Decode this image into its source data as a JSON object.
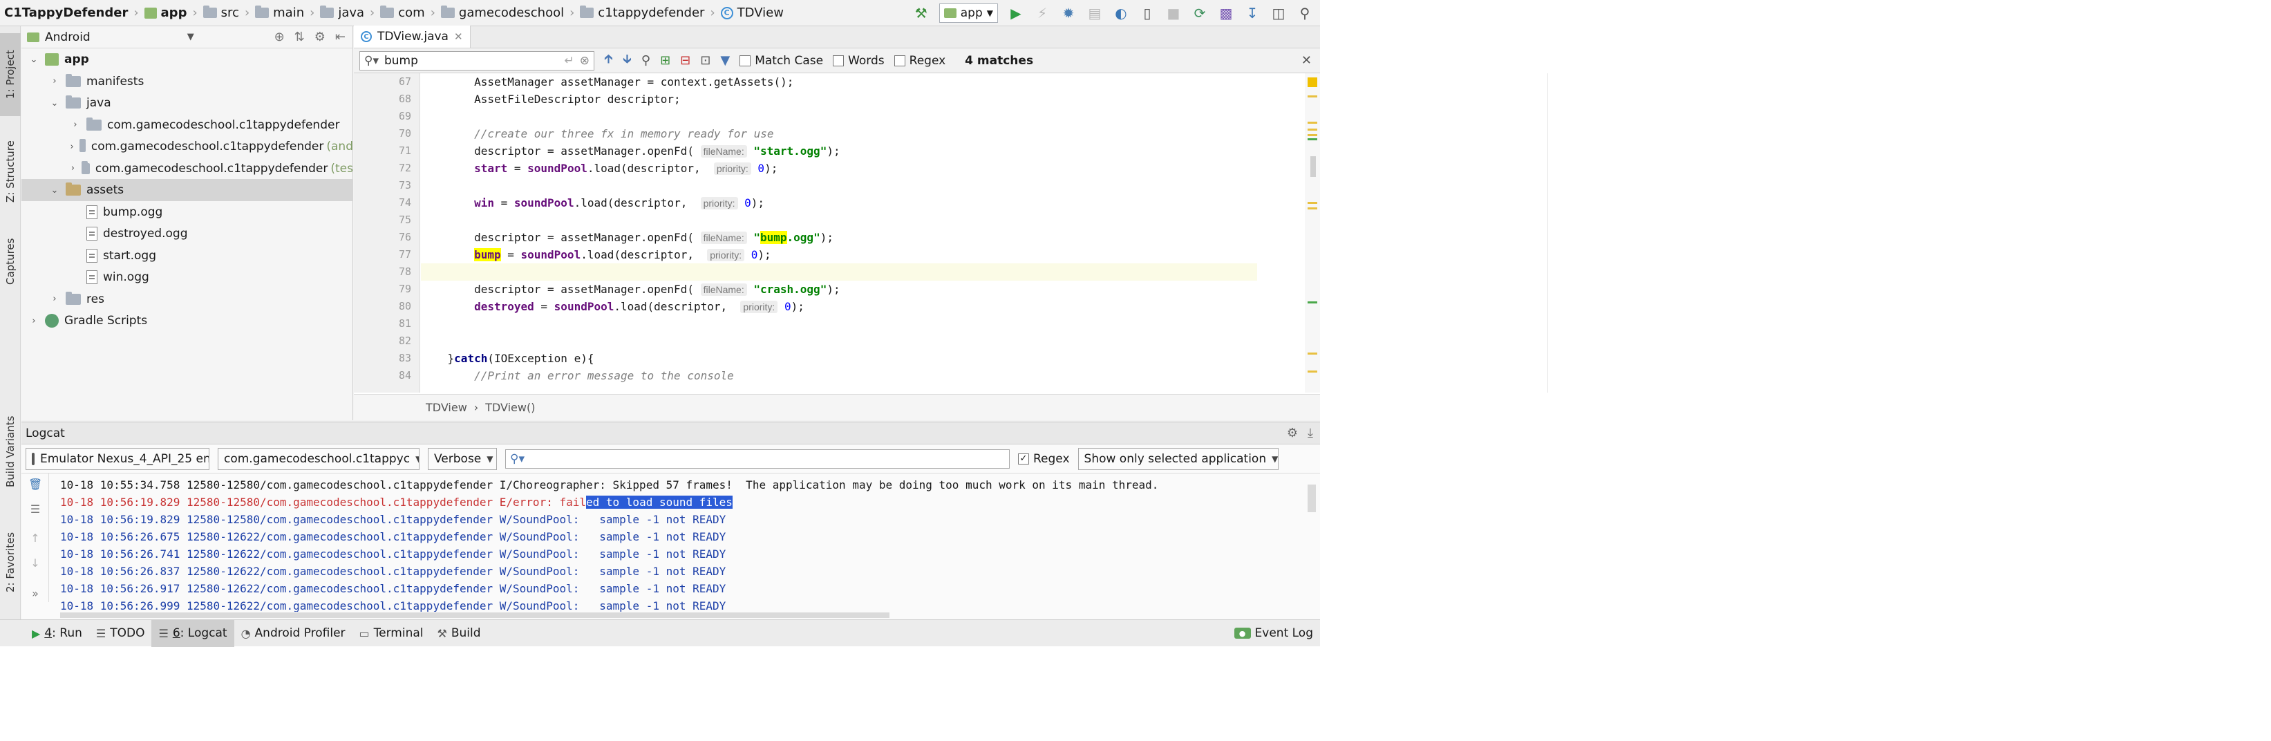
{
  "breadcrumbs": [
    "C1TappyDefender",
    "app",
    "src",
    "main",
    "java",
    "com",
    "gamecodeschool",
    "c1tappydefender",
    "TDView"
  ],
  "run_config": "app",
  "left_stripe_tabs": [
    "1: Project",
    "Z: Structure",
    "Captures",
    "Build Variants",
    "2: Favorites"
  ],
  "project_panel": {
    "view_label": "Android",
    "tree": [
      {
        "label": "app",
        "hint": "",
        "depth": 0,
        "kind": "module",
        "expanded": true,
        "bold": true
      },
      {
        "label": "manifests",
        "hint": "",
        "depth": 1,
        "kind": "folder",
        "expanded": false
      },
      {
        "label": "java",
        "hint": "",
        "depth": 1,
        "kind": "folder",
        "expanded": true
      },
      {
        "label": "com.gamecodeschool.c1tappydefender",
        "hint": "",
        "depth": 2,
        "kind": "folder",
        "expanded": false
      },
      {
        "label": "com.gamecodeschool.c1tappydefender",
        "hint": "(and",
        "depth": 2,
        "kind": "folder",
        "expanded": false
      },
      {
        "label": "com.gamecodeschool.c1tappydefender",
        "hint": "(tes",
        "depth": 2,
        "kind": "folder",
        "expanded": false
      },
      {
        "label": "assets",
        "hint": "",
        "depth": 1,
        "kind": "assets",
        "expanded": true,
        "selected": true
      },
      {
        "label": "bump.ogg",
        "hint": "",
        "depth": 2,
        "kind": "file"
      },
      {
        "label": "destroyed.ogg",
        "hint": "",
        "depth": 2,
        "kind": "file"
      },
      {
        "label": "start.ogg",
        "hint": "",
        "depth": 2,
        "kind": "file"
      },
      {
        "label": "win.ogg",
        "hint": "",
        "depth": 2,
        "kind": "file"
      },
      {
        "label": "res",
        "hint": "",
        "depth": 1,
        "kind": "folder",
        "expanded": false
      },
      {
        "label": "Gradle Scripts",
        "hint": "",
        "depth": 0,
        "kind": "gradle",
        "expanded": false
      }
    ]
  },
  "editor": {
    "tab_label": "TDView.java",
    "find": {
      "query": "bump",
      "match_case_label": "Match Case",
      "words_label": "Words",
      "regex_label": "Regex",
      "matches": "4 matches"
    },
    "line_numbers": [
      "67",
      "68",
      "69",
      "70",
      "71",
      "72",
      "73",
      "74",
      "75",
      "76",
      "77",
      "78",
      "79",
      "80",
      "81",
      "82",
      "83",
      "84"
    ],
    "breadcrumb": [
      "TDView",
      "TDView()"
    ]
  },
  "logcat": {
    "title": "Logcat",
    "device": "Emulator Nexus_4_API_25 en",
    "package": "com.gamecodeschool.c1tappyc",
    "level": "Verbose",
    "search_value": "",
    "regex_label": "Regex",
    "filter": "Show only selected application",
    "lines": [
      {
        "level": "I",
        "pre": "10-18 10:55:34.758 12580-12580/com.gamecodeschool.c1tappydefender I/Choreographer: Skipped 57 frames!  The application may be doing too much work on its main thread.",
        "sel": "",
        "post": ""
      },
      {
        "level": "E",
        "pre": "10-18 10:56:19.829 12580-12580/com.gamecodeschool.c1tappydefender E/error: fail",
        "sel": "ed to load sound files",
        "post": ""
      },
      {
        "level": "W",
        "pre": "10-18 10:56:19.829 12580-12580/com.gamecodeschool.c1tappydefender W/SoundPool:   sample -1 not READY",
        "sel": "",
        "post": ""
      },
      {
        "level": "W",
        "pre": "10-18 10:56:26.675 12580-12622/com.gamecodeschool.c1tappydefender W/SoundPool:   sample -1 not READY",
        "sel": "",
        "post": ""
      },
      {
        "level": "W",
        "pre": "10-18 10:56:26.741 12580-12622/com.gamecodeschool.c1tappydefender W/SoundPool:   sample -1 not READY",
        "sel": "",
        "post": ""
      },
      {
        "level": "W",
        "pre": "10-18 10:56:26.837 12580-12622/com.gamecodeschool.c1tappydefender W/SoundPool:   sample -1 not READY",
        "sel": "",
        "post": ""
      },
      {
        "level": "W",
        "pre": "10-18 10:56:26.917 12580-12622/com.gamecodeschool.c1tappydefender W/SoundPool:   sample -1 not READY",
        "sel": "",
        "post": ""
      },
      {
        "level": "W",
        "pre": "10-18 10:56:26.999 12580-12622/com.gamecodeschool.c1tappydefender W/SoundPool:   sample -1 not READY",
        "sel": "",
        "post": ""
      }
    ]
  },
  "bottom_tabs": [
    {
      "num": "4",
      "label": ": Run",
      "icon": "run-icon"
    },
    {
      "num": "",
      "label": "TODO",
      "icon": "todo-icon"
    },
    {
      "num": "6",
      "label": ": Logcat",
      "icon": "logcat-icon",
      "active": true
    },
    {
      "num": "",
      "label": "Android Profiler",
      "icon": "profiler-icon"
    },
    {
      "num": "",
      "label": "Terminal",
      "icon": "terminal-icon"
    },
    {
      "num": "",
      "label": "Build",
      "icon": "build-icon"
    }
  ],
  "event_log": "Event Log"
}
